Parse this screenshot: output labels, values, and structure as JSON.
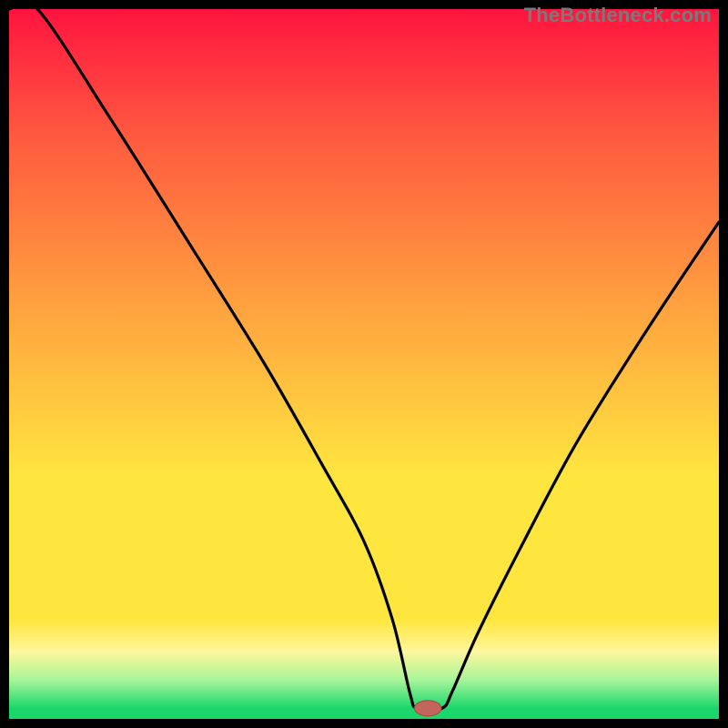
{
  "watermark": "TheBottleneck.com",
  "colors": {
    "frame": "#000000",
    "top": "#ff143f",
    "midred": "#ff5a3f",
    "orange": "#ffa23f",
    "yellow": "#ffe63f",
    "paleyellow": "#fff69a",
    "palegreen": "#a8f59a",
    "green": "#1bd66b",
    "curve": "#000000",
    "marker_fill": "#c4655c",
    "marker_stroke": "#a34a41"
  },
  "chart_data": {
    "type": "line",
    "title": "",
    "xlabel": "",
    "ylabel": "",
    "xlim": [
      0,
      100
    ],
    "ylim": [
      0,
      100
    ],
    "grid": false,
    "series": [
      {
        "name": "bottleneck-curve",
        "x": [
          0,
          4,
          14,
          26,
          36,
          44,
          50,
          54,
          56.5,
          57.5,
          61,
          62.5,
          66,
          72,
          80,
          90,
          100
        ],
        "y": [
          100,
          100,
          85,
          66,
          50,
          36,
          25,
          14,
          3.5,
          1.5,
          1.5,
          4,
          12,
          24,
          39,
          55,
          70
        ]
      }
    ],
    "marker": {
      "x": 59,
      "y": 1.5,
      "rx": 1.9,
      "ry": 1.1
    }
  }
}
